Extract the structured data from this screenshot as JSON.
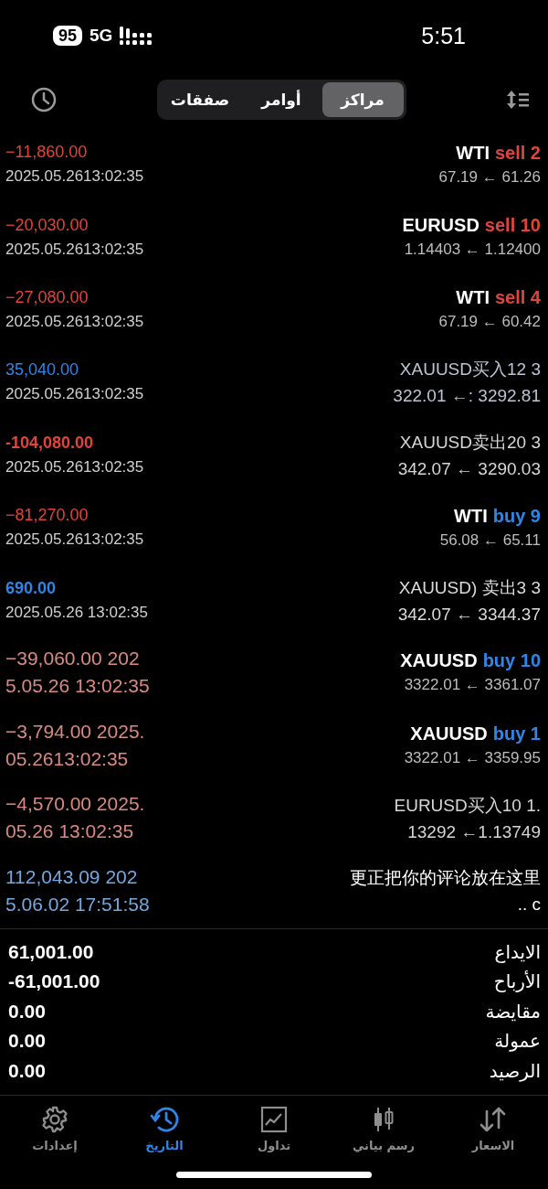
{
  "status_bar": {
    "battery": "95",
    "network": "5G",
    "time": "5:51"
  },
  "segments": [
    {
      "label": "مراكز",
      "selected": true
    },
    {
      "label": "أوامر",
      "selected": false
    },
    {
      "label": "صفقات",
      "selected": false
    }
  ],
  "rows": [
    {
      "kind": "order",
      "symbol": "WTI",
      "side": {
        "text": "sell 2",
        "kind": "sell"
      },
      "prices": "67.19 ← 61.26",
      "profit": {
        "text": "−11,860.00",
        "color": "#e0443a",
        "bold": false
      },
      "time": {
        "text": "2025.05.2613:02:35",
        "color": "#d0d0d0"
      }
    },
    {
      "kind": "order",
      "symbol": "EURUSD",
      "side": {
        "text": "sell 10",
        "kind": "sell"
      },
      "prices": "1.14403 ← 1.12400",
      "profit": {
        "text": "−20,030.00",
        "color": "#e0443a",
        "bold": false
      },
      "time": {
        "text": "2025.05.2613:02:35",
        "color": "#d0d0d0"
      }
    },
    {
      "kind": "order",
      "symbol": "WTI",
      "side": {
        "text": "sell 4",
        "kind": "sell"
      },
      "prices": "67.19 ← 60.42",
      "profit": {
        "text": "−27,080.00",
        "color": "#e0443a",
        "bold": false
      },
      "time": {
        "text": "2025.05.2613:02:35",
        "color": "#d0d0d0"
      }
    },
    {
      "kind": "note",
      "line1": "XAUUSD买入12 3",
      "line2": "322.01 ←: 3292.81",
      "color": "#b9c4d4",
      "profit": {
        "text": "35,040.00",
        "color": "#2f86e6",
        "bold": false
      },
      "time": {
        "text": "2025.05.2613:02:35",
        "color": "#d0d0d0"
      }
    },
    {
      "kind": "note",
      "line1": "XAUUSD卖出20 3",
      "line2": "342.07 ← 3290.03",
      "color": "#d6d6d6",
      "profit": {
        "text": "-104,080.00",
        "color": "#e0443a",
        "bold": true
      },
      "time": {
        "text": "2025.05.2613:02:35",
        "color": "#d0d0d0"
      }
    },
    {
      "kind": "order",
      "symbol": "WTI",
      "side": {
        "text": "buy 9",
        "kind": "buy"
      },
      "prices": "56.08 ← 65.11",
      "profit": {
        "text": "−81,270.00",
        "color": "#e0443a",
        "bold": false
      },
      "time": {
        "text": "2025.05.2613:02:35",
        "color": "#d0d0d0"
      }
    },
    {
      "kind": "note",
      "line1": "XAUUSD) 卖出3 3",
      "line2": "342.07 ← 3344.37",
      "color": "#dcdcdc",
      "profit": {
        "text": "690.00",
        "color": "#2f86e6",
        "bold": true
      },
      "time": {
        "text": "2025.05.26 13:02:35",
        "color": "#d0d0d0"
      }
    },
    {
      "kind": "order",
      "symbol": "XAUUSD",
      "side": {
        "text": "buy 10",
        "kind": "buy"
      },
      "prices": "3322.01 ← 3361.07",
      "profit": {
        "text": "−39,060.00 202",
        "color": "#d98a80",
        "bold": false,
        "large": true
      },
      "time": {
        "text": "5.05.26 13:02:35",
        "color": "#d98a80",
        "large": true
      }
    },
    {
      "kind": "order",
      "symbol": "XAUUSD",
      "side": {
        "text": "buy 1",
        "kind": "buy"
      },
      "prices": "3322.01 ← 3359.95",
      "profit": {
        "text": "−3,794.00 2025.",
        "color": "#d98a80",
        "bold": false,
        "large": true
      },
      "time": {
        "text": "05.2613:02:35",
        "color": "#d98a80",
        "large": true
      }
    },
    {
      "kind": "note",
      "line1": "EURUSD买入10 1.",
      "line2": "13292 ←1.13749",
      "color": "#d6d6d6",
      "profit": {
        "text": "−4,570.00 2025.",
        "color": "#d98a80",
        "bold": false,
        "large": true
      },
      "time": {
        "text": "05.26 13:02:35",
        "color": "#d98a80",
        "large": true
      }
    },
    {
      "kind": "note",
      "line1": "更正把你的评论放在这里",
      "line2": ".. c",
      "color": "#ffffff",
      "profit": {
        "text": "112,043.09 202",
        "color": "#74a8e0",
        "bold": false,
        "large": true
      },
      "time": {
        "text": "5.06.02 17:51:58",
        "color": "#74a8e0",
        "large": true
      }
    }
  ],
  "summary": [
    {
      "label": "الايداع",
      "value": "61,001.00"
    },
    {
      "label": "الأرباح",
      "value": "-61,001.00"
    },
    {
      "label": "مقايضة",
      "value": "0.00"
    },
    {
      "label": "عمولة",
      "value": "0.00"
    },
    {
      "label": "الرصيد",
      "value": "0.00"
    }
  ],
  "nav": [
    {
      "label": "الاسعار",
      "selected": false
    },
    {
      "label": "رسم بياني",
      "selected": false
    },
    {
      "label": "تداول",
      "selected": false
    },
    {
      "label": "التاريخ",
      "selected": true
    },
    {
      "label": "إعدادات",
      "selected": false
    }
  ]
}
